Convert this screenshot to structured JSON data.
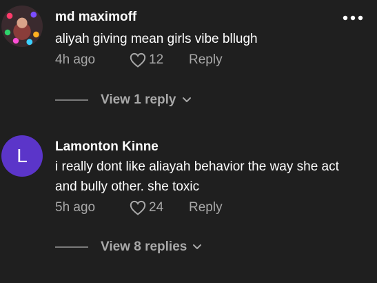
{
  "comments": [
    {
      "username": "md maximoff",
      "text": "aliyah giving mean girls vibe bllugh",
      "time": "4h ago",
      "likes": "12",
      "reply_label": "Reply",
      "view_replies_label": "View 1 reply",
      "avatar_letter": ""
    },
    {
      "username": "Lamonton Kinne",
      "text": "i really dont like aliayah behavior the way she act and bully other. she toxic",
      "time": "5h ago",
      "likes": "24",
      "reply_label": "Reply",
      "view_replies_label": "View 8 replies",
      "avatar_letter": "L",
      "avatar_color": "#5b35c9"
    }
  ],
  "icons": {
    "like": "heart-icon",
    "more": "more-options-icon",
    "expand": "chevron-down-icon"
  },
  "colors": {
    "background": "#1f1f1f",
    "primary_text": "#ffffff",
    "secondary_text": "#a8a8a8"
  }
}
